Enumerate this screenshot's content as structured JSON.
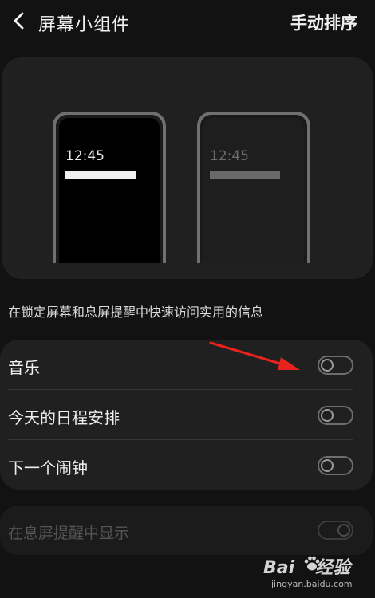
{
  "header": {
    "title": "屏幕小组件",
    "sort_label": "手动排序"
  },
  "preview": {
    "left_time": "12:45",
    "right_time": "12:45"
  },
  "description": "在锁定屏幕和息屏提醒中快速访问实用的信息",
  "settings": {
    "items": [
      {
        "label": "音乐",
        "enabled": false
      },
      {
        "label": "今天的日程安排",
        "enabled": false
      },
      {
        "label": "下一个闹钟",
        "enabled": false
      }
    ]
  },
  "aod": {
    "label": "在息屏提醒中显示",
    "enabled": true,
    "disabled": true
  },
  "annotation": {
    "arrow_color": "#e8231d"
  },
  "watermark": {
    "logo_part1": "Bai",
    "logo_part2": "经验",
    "url": "jingyan.baidu.com"
  },
  "colors": {
    "background": "#121212",
    "card": "#202020",
    "text": "#efefef"
  }
}
